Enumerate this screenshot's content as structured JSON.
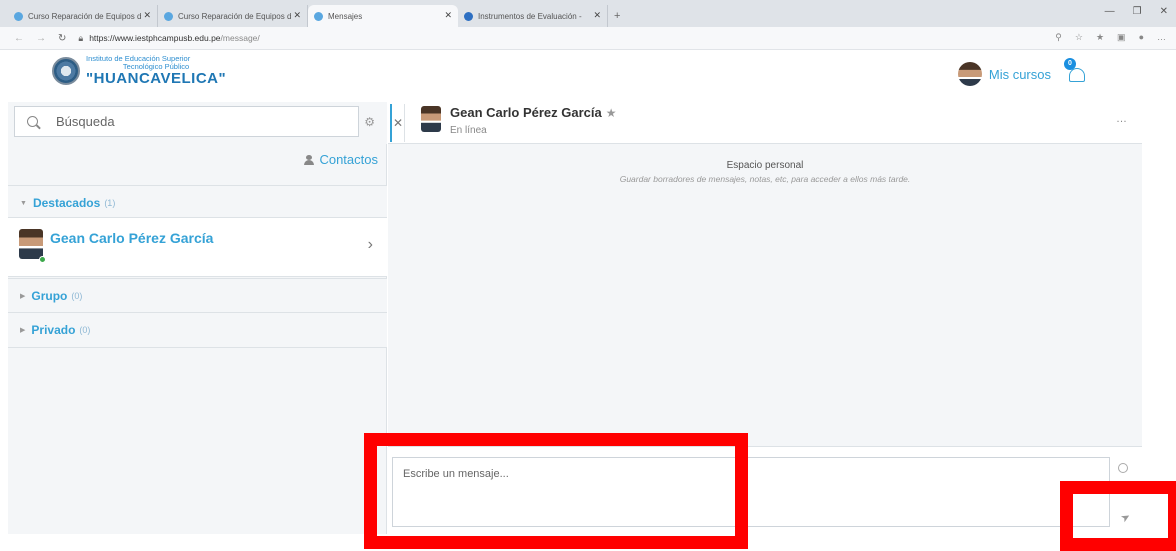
{
  "browser": {
    "tabs": [
      {
        "label": "Curso Reparación de Equipos d",
        "active": false
      },
      {
        "label": "Curso Reparación de Equipos d",
        "active": false
      },
      {
        "label": "Mensajes",
        "active": true
      },
      {
        "label": "Instrumentos de Evaluación - ",
        "active": false
      }
    ],
    "url_host": "https://www.iestphcampusb.edu.pe",
    "url_path": "/message/"
  },
  "site": {
    "logo_line1": "Instituto de Educación Superior",
    "logo_line2": "Tecnológico Público",
    "logo_name": "\"HUANCAVELICA\"",
    "user_menu_label": "Mis cursos",
    "notification_count": "0"
  },
  "left": {
    "search_placeholder": "Búsqueda",
    "contacts_label": "Contactos",
    "sections": [
      {
        "title": "Destacados",
        "count": "(1)"
      },
      {
        "title": "Grupo",
        "count": "(0)"
      },
      {
        "title": "Privado",
        "count": "(0)"
      }
    ],
    "conversation": {
      "name": "Gean Carlo Pérez García"
    }
  },
  "right": {
    "contact_name": "Gean Carlo Pérez García",
    "status": "En línea",
    "more": "…",
    "personal_space_title": "Espacio personal",
    "personal_space_desc": "Guardar borradores de mensajes, notas, etc, para acceder a ellos más tarde.",
    "message_placeholder": "Escribe un mensaje..."
  },
  "colors": {
    "accent": "#35a2d6",
    "annotation": "#ff0000",
    "online": "#3ca84b"
  }
}
